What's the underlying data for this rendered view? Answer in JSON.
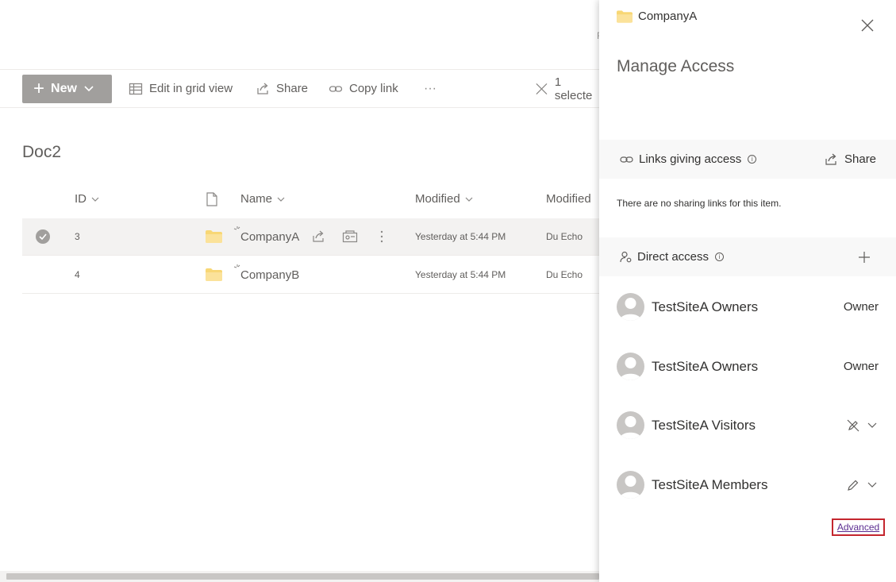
{
  "commandbar": {
    "new_label": "New",
    "edit_grid_label": "Edit in grid view",
    "share_label": "Share",
    "copy_link_label": "Copy link",
    "more_label": "···",
    "selected_label": "1 selecte"
  },
  "library": {
    "title": "Doc2",
    "columns": {
      "id": "ID",
      "name": "Name",
      "modified": "Modified",
      "modified_by": "Modified"
    },
    "rows": [
      {
        "id": "3",
        "name": "CompanyA",
        "modified": "Yesterday at 5:44 PM",
        "modified_by": "Du Echo",
        "selected": true
      },
      {
        "id": "4",
        "name": "CompanyB",
        "modified": "Yesterday at 5:44 PM",
        "modified_by": "Du Echo",
        "selected": false
      }
    ],
    "peek_text": "F"
  },
  "panel": {
    "item_name": "CompanyA",
    "title": "Manage Access",
    "links_section": {
      "label": "Links giving access",
      "share_label": "Share",
      "empty_text": "There are no sharing links for this item."
    },
    "direct_section": {
      "label": "Direct access"
    },
    "people": [
      {
        "name": "TestSiteA Owners",
        "role": "Owner",
        "permission_icon": ""
      },
      {
        "name": "TestSiteA Owners",
        "role": "Owner",
        "permission_icon": ""
      },
      {
        "name": "TestSiteA Visitors",
        "role": "",
        "permission_icon": "no-edit-icon"
      },
      {
        "name": "TestSiteA Members",
        "role": "",
        "permission_icon": "edit-icon"
      }
    ],
    "advanced_label": "Advanced"
  },
  "colors": {
    "accent_highlight": "#c4262e",
    "new_button_bg": "#a19f9d",
    "link_color": "#5c2d91",
    "folder": "#f8d775"
  }
}
